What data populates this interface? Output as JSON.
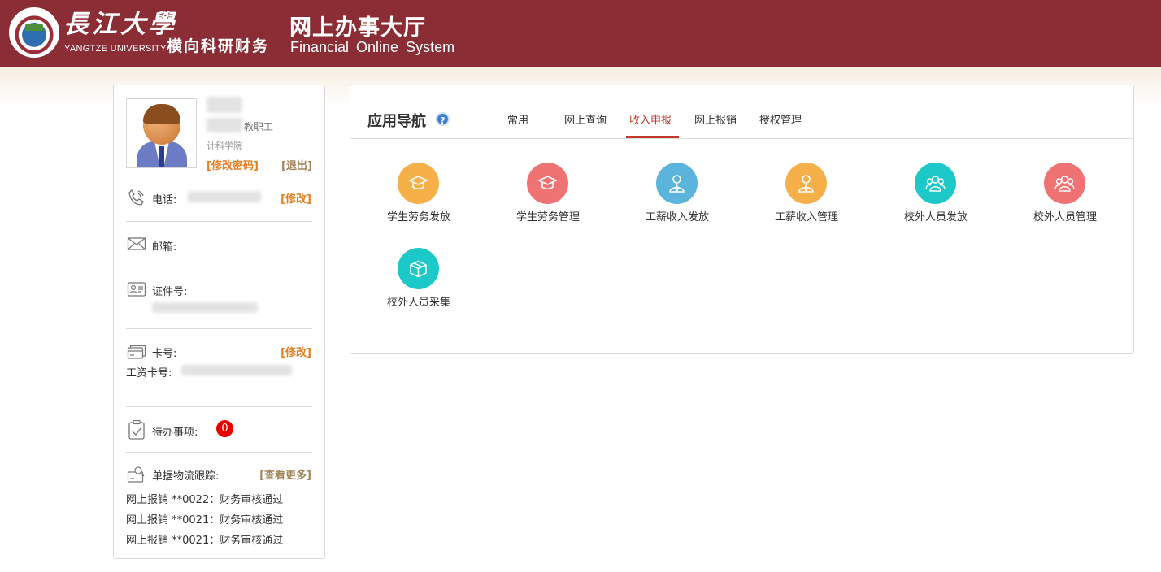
{
  "header": {
    "logo_cn": "長江大學",
    "logo_en": "YANGTZE UNIVERSITY",
    "logo_sub": "横向科研财务",
    "title": "网上办事大厅",
    "subtitle": "Financial Online System"
  },
  "profile": {
    "role": "教职工",
    "dept": "计科学院",
    "change_password": "[修改密码]",
    "logout": "[退出]",
    "phone_label": "电话:",
    "phone_edit": "[修改]",
    "email_label": "邮箱:",
    "id_label": "证件号:",
    "card_label": "卡号:",
    "card_edit": "[修改]",
    "salary_card_label": "工资卡号:",
    "todo_label": "待办事项:",
    "todo_count": "0",
    "tracking_label": "单据物流跟踪:",
    "tracking_more": "[查看更多]",
    "tracking_items": [
      "网上报销 **0022：财务审核通过",
      "网上报销 **0021：财务审核通过",
      "网上报销 **0021：财务审核通过"
    ]
  },
  "nav": {
    "title": "应用导航",
    "help": "?",
    "tabs": [
      "常用",
      "网上查询",
      "收入申报",
      "网上报销",
      "授权管理"
    ],
    "active_tab": "收入申报",
    "apps": [
      {
        "label": "学生劳务发放",
        "icon": "graduation-cap-icon",
        "color": "#f5b04a"
      },
      {
        "label": "学生劳务管理",
        "icon": "graduation-cap-icon",
        "color": "#f07373"
      },
      {
        "label": "工薪收入发放",
        "icon": "person-tie-icon",
        "color": "#5ab4dc"
      },
      {
        "label": "工薪收入管理",
        "icon": "person-tie-icon",
        "color": "#f5b04a"
      },
      {
        "label": "校外人员发放",
        "icon": "group-icon",
        "color": "#1cc8c8"
      },
      {
        "label": "校外人员管理",
        "icon": "group-icon",
        "color": "#f07373"
      },
      {
        "label": "校外人员采集",
        "icon": "box-icon",
        "color": "#1cc8c8"
      }
    ]
  }
}
